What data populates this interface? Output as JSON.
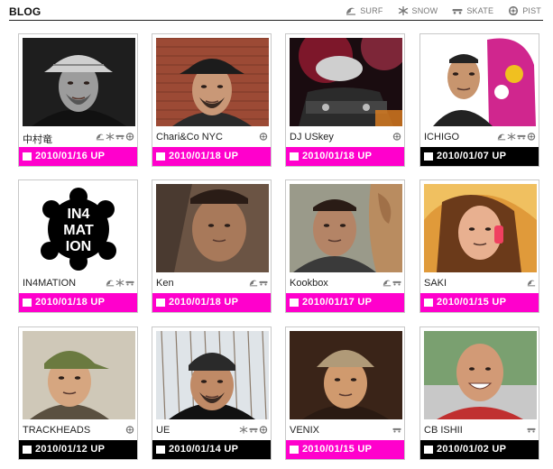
{
  "header": {
    "title": "BLOG",
    "filters": [
      {
        "icon": "surf-icon",
        "label": "SURF"
      },
      {
        "icon": "snow-icon",
        "label": "SNOW"
      },
      {
        "icon": "skate-icon",
        "label": "SKATE"
      },
      {
        "icon": "pist-icon",
        "label": "PIST"
      }
    ]
  },
  "colors": {
    "accent_pink": "#ff00cc",
    "black": "#000000",
    "icon_gray": "#777777"
  },
  "cards": [
    {
      "name": "中村竜",
      "date": "2010/01/16 UP",
      "bar": "pink",
      "icons": [
        "surf-icon",
        "snow-icon",
        "skate-icon",
        "pist-icon"
      ],
      "photo": "portrait-hat-bw"
    },
    {
      "name": "Chari&Co NYC",
      "date": "2010/01/18 UP",
      "bar": "pink",
      "icons": [
        "pist-icon"
      ],
      "photo": "portrait-fedora-brick"
    },
    {
      "name": "DJ USkey",
      "date": "2010/01/18 UP",
      "bar": "pink",
      "icons": [
        "pist-icon"
      ],
      "photo": "dj-red-light"
    },
    {
      "name": "ICHIGO",
      "date": "2010/01/07 UP",
      "bar": "black",
      "icons": [
        "surf-icon",
        "snow-icon",
        "skate-icon",
        "pist-icon"
      ],
      "photo": "snowboard-man"
    },
    {
      "name": "IN4MATION",
      "date": "2010/01/18 UP",
      "bar": "pink",
      "icons": [
        "surf-icon",
        "snow-icon",
        "skate-icon"
      ],
      "photo": "in4mation-logo",
      "logo_text": [
        "IN4",
        "MAT",
        "ION"
      ]
    },
    {
      "name": "Ken",
      "date": "2010/01/18 UP",
      "bar": "pink",
      "icons": [
        "surf-icon",
        "skate-icon"
      ],
      "photo": "portrait-closeup"
    },
    {
      "name": "Kookbox",
      "date": "2010/01/17 UP",
      "bar": "pink",
      "icons": [
        "surf-icon",
        "skate-icon"
      ],
      "photo": "portrait-dog-man"
    },
    {
      "name": "SAKI",
      "date": "2010/01/15 UP",
      "bar": "pink",
      "icons": [
        "surf-icon"
      ],
      "photo": "woman-phone"
    },
    {
      "name": "TRACKHEADS",
      "date": "2010/01/12 UP",
      "bar": "black",
      "icons": [
        "pist-icon"
      ],
      "photo": "portrait-green-cap"
    },
    {
      "name": "UE",
      "date": "2010/01/14 UP",
      "bar": "black",
      "icons": [
        "snow-icon",
        "skate-icon",
        "pist-icon"
      ],
      "photo": "portrait-beanie-trees"
    },
    {
      "name": "VENIX",
      "date": "2010/01/15 UP",
      "bar": "pink",
      "icons": [
        "skate-icon"
      ],
      "photo": "portrait-cap-dark"
    },
    {
      "name": "CB ISHII",
      "date": "2010/01/02 UP",
      "bar": "black",
      "icons": [
        "skate-icon"
      ],
      "photo": "portrait-bald-smile"
    }
  ]
}
